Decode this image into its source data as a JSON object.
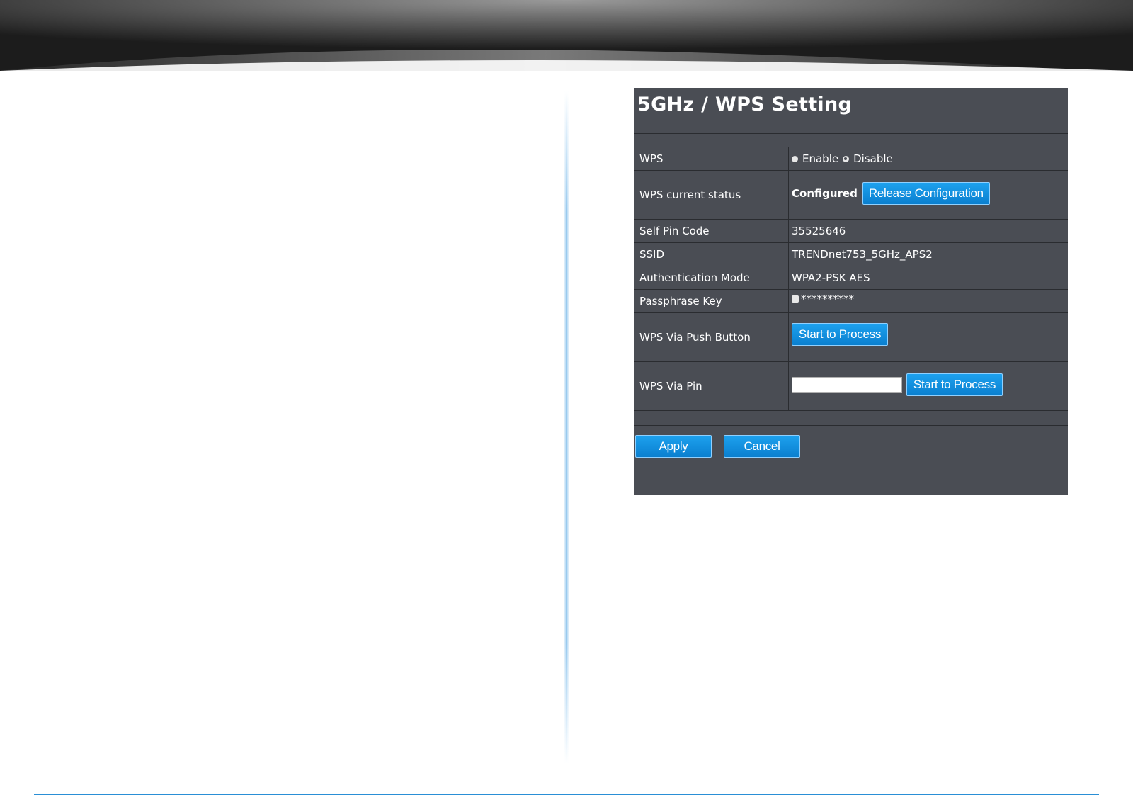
{
  "panel": {
    "title": "5GHz / WPS Setting"
  },
  "rows": {
    "wps": {
      "label": "WPS",
      "options": [
        "Enable",
        "Disable"
      ],
      "selected": "Disable"
    },
    "status": {
      "label": "WPS current status",
      "value": "Configured",
      "button": "Release Configuration"
    },
    "pin_code": {
      "label": "Self Pin Code",
      "value": "35525646"
    },
    "ssid": {
      "label": "SSID",
      "value": "TRENDnet753_5GHz_APS2"
    },
    "auth": {
      "label": "Authentication Mode",
      "value": "WPA2-PSK AES"
    },
    "passphrase": {
      "label": "Passphrase Key",
      "value": "**********",
      "show_checked": false
    },
    "push_button": {
      "label": "WPS Via Push Button",
      "button": "Start to Process"
    },
    "via_pin": {
      "label": "WPS Via Pin",
      "input_value": "",
      "button": "Start to Process"
    }
  },
  "footer": {
    "apply": "Apply",
    "cancel": "Cancel"
  },
  "colors": {
    "panel_bg": "#4a4d54",
    "button_blue": "#1290e0",
    "accent_rule": "#2a8fd6"
  }
}
